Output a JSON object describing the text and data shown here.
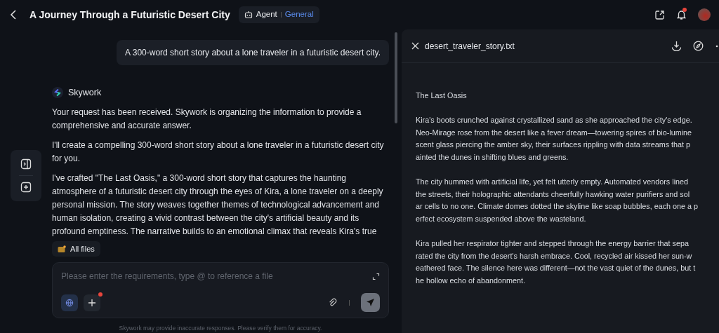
{
  "header": {
    "title": "A Journey Through a Futuristic Desert City",
    "mode_label": "Agent",
    "mode_value": "General",
    "notifications_unread": true
  },
  "chat": {
    "user_message": "A 300-word short story about a lone traveler in a futuristic desert city.",
    "assistant": {
      "name": "Skywork",
      "paragraphs": [
        "Your request has been received. Skywork is organizing the information to provide a comprehensive and accurate answer.",
        "I'll create a compelling 300-word short story about a lone traveler in a futuristic desert city for you.",
        "I've crafted \"The Last Oasis,\" a 300-word short story that captures the haunting atmosphere of a futuristic desert city through the eyes of Kira, a lone traveler on a deeply personal mission. The story weaves together themes of technological advancement and human isolation, creating a vivid contrast between the city's artificial beauty and its profound emptiness. The narrative builds to an emotional climax that reveals Kira's true"
      ]
    }
  },
  "files_chip": {
    "label": "All files"
  },
  "composer": {
    "placeholder": "Please enter the requirements, type @ to reference a file",
    "add_badge": true
  },
  "disclaimer": "Skywork may provide inaccurate responses. Please verify them for accuracy.",
  "file_panel": {
    "filename": "desert_traveler_story.txt",
    "paragraphs": [
      [
        "The Last Oasis"
      ],
      [
        "Kira's boots crunched against crystallized sand as she approached the city's edge.",
        "Neo-Mirage rose from the desert like a fever dream—towering spires of bio-lumine",
        "scent glass piercing the amber sky, their surfaces rippling with data streams that p",
        "ainted the dunes in shifting blues and greens."
      ],
      [
        "The city hummed with artificial life, yet felt utterly empty. Automated vendors lined",
        "the streets, their holographic attendants cheerfully hawking water purifiers and sol",
        "ar cells to no one. Climate domes dotted the skyline like soap bubbles, each one a p",
        "erfect ecosystem suspended above the wasteland."
      ],
      [
        "Kira pulled her respirator tighter and stepped through the energy barrier that sepa",
        "rated the city from the desert's harsh embrace. Cool, recycled air kissed her sun-w",
        "eathered face. The silence here was different—not the vast quiet of the dunes, but t",
        "he hollow echo of abandonment."
      ]
    ]
  }
}
